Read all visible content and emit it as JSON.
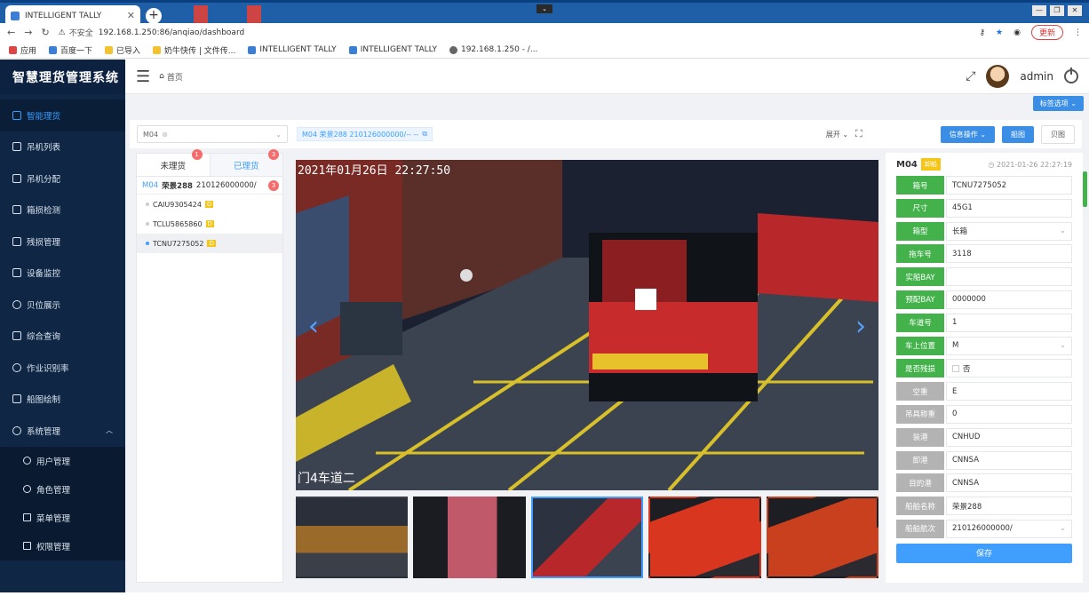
{
  "browser": {
    "tab_title": "INTELLIGENT TALLY",
    "insecure": "不安全",
    "url": "192.168.1.250:86/anqiao/dashboard",
    "update": "更新",
    "bookmarks": [
      "应用",
      "百度一下",
      "已导入",
      "奶牛快传 | 文件传...",
      "INTELLIGENT TALLY",
      "INTELLIGENT TALLY",
      "192.168.1.250 - /..."
    ]
  },
  "app": {
    "title": "智慧理货管理系统",
    "breadcrumb": "首页",
    "user": "admin",
    "tag_select": "标签选项"
  },
  "sidebar": {
    "items": [
      {
        "label": "智能理货",
        "active": true
      },
      {
        "label": "吊机列表"
      },
      {
        "label": "吊机分配"
      },
      {
        "label": "箱损检测"
      },
      {
        "label": "残损管理"
      },
      {
        "label": "设备监控"
      },
      {
        "label": "贝位展示"
      },
      {
        "label": "综合查询"
      },
      {
        "label": "作业识别率"
      },
      {
        "label": "船图绘制"
      },
      {
        "label": "系统管理"
      }
    ],
    "sub_items": [
      "用户管理",
      "角色管理",
      "菜单管理",
      "权限管理"
    ]
  },
  "toolbar": {
    "select_value": "M04",
    "chip": "M04  荣景288  210126000000/--  --",
    "expand": "展开",
    "info_ops": "信息操作",
    "ship_view": "船图",
    "bay_view": "贝图"
  },
  "left_panel": {
    "tab_pending": "未理货",
    "tab_pending_count": "1",
    "tab_done": "已理货",
    "tab_done_count": "3",
    "group": {
      "crane": "M04",
      "ship": "荣景288",
      "voyage": "210126000000/",
      "count": "3"
    },
    "rows": [
      {
        "id": "CAIU9305424",
        "tag": "D",
        "selected": false
      },
      {
        "id": "TCLU5865860",
        "tag": "D",
        "selected": false
      },
      {
        "id": "TCNU7275052",
        "tag": "D",
        "selected": true
      }
    ]
  },
  "main_image": {
    "datetime": "2021年01月26日  22:27:50",
    "lane": "门4车道二"
  },
  "right_panel": {
    "crane": "M04",
    "status": "卸船",
    "time": "2021-01-26 22:27:19",
    "fields": [
      {
        "label": "箱号",
        "value": "TCNU7275052",
        "color": "g"
      },
      {
        "label": "尺寸",
        "value": "45G1",
        "color": "g"
      },
      {
        "label": "箱型",
        "value": "长箱",
        "color": "g",
        "dropdown": true
      },
      {
        "label": "拖车号",
        "value": "3118",
        "color": "g"
      },
      {
        "label": "实船BAY",
        "value": "",
        "color": "g"
      },
      {
        "label": "预配BAY",
        "value": "0000000",
        "color": "g"
      },
      {
        "label": "车道号",
        "value": "1",
        "color": "g"
      },
      {
        "label": "车上位置",
        "value": "M",
        "color": "g",
        "dropdown": true
      },
      {
        "label": "是否残损",
        "value": "否",
        "color": "g",
        "checkbox": true
      },
      {
        "label": "空重",
        "value": "E",
        "color": "gr"
      },
      {
        "label": "吊具称重",
        "value": "0",
        "color": "gr"
      },
      {
        "label": "装港",
        "value": "CNHUD",
        "color": "gr"
      },
      {
        "label": "卸港",
        "value": "CNNSA",
        "color": "gr"
      },
      {
        "label": "目的港",
        "value": "CNNSA",
        "color": "gr"
      },
      {
        "label": "船舶名称",
        "value": "荣景288",
        "color": "gr"
      },
      {
        "label": "船舶航次",
        "value": "210126000000/",
        "color": "gr",
        "dropdown": true
      }
    ],
    "save": "保存"
  }
}
